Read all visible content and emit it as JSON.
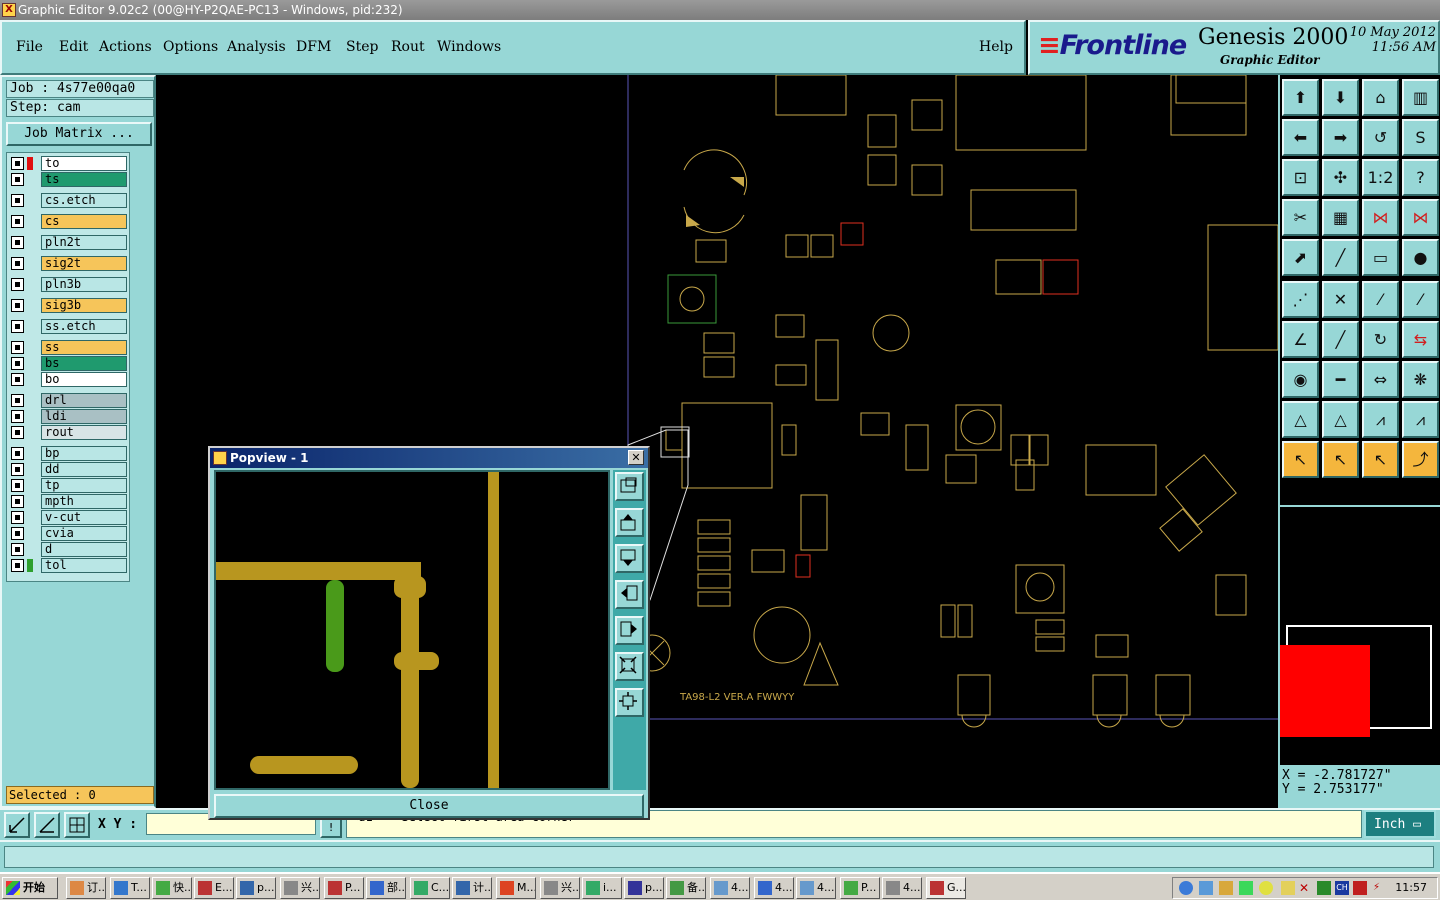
{
  "window": {
    "title": "Graphic Editor 9.02c2 (00@HY-P2QAE-PC13 - Windows, pid:232)"
  },
  "menu": {
    "items": [
      "File",
      "Edit",
      "Actions",
      "Options",
      "Analysis",
      "DFM",
      "Step",
      "Rout",
      "Windows"
    ],
    "help": "Help"
  },
  "brand": {
    "logo": "Frontline",
    "product": "Genesis 2000",
    "subtitle": "Graphic Editor",
    "date": "10 May 2012",
    "time": "11:56 AM"
  },
  "job": {
    "job_label": "Job : 4s77e00qa0",
    "step_label": "Step: cam",
    "matrix_button": "Job Matrix ..."
  },
  "layers": [
    {
      "name": "to",
      "color": "#ffffff",
      "swatch": "#e01010"
    },
    {
      "name": "ts",
      "color": "#1f9a6e",
      "swatch": ""
    },
    {
      "name": "cs.etch",
      "color": "#b9e6e5",
      "swatch": ""
    },
    {
      "name": "cs",
      "color": "#f6c55a",
      "swatch": ""
    },
    {
      "name": "pln2t",
      "color": "#b9e6e5",
      "swatch": ""
    },
    {
      "name": "sig2t",
      "color": "#f6c55a",
      "swatch": ""
    },
    {
      "name": "pln3b",
      "color": "#b9e6e5",
      "swatch": ""
    },
    {
      "name": "sig3b",
      "color": "#f6c55a",
      "swatch": ""
    },
    {
      "name": "ss.etch",
      "color": "#b9e6e5",
      "swatch": ""
    },
    {
      "name": "ss",
      "color": "#f6c55a",
      "swatch": ""
    },
    {
      "name": "bs",
      "color": "#1f9a6e",
      "swatch": ""
    },
    {
      "name": "bo",
      "color": "#ffffff",
      "swatch": ""
    },
    {
      "name": "drl",
      "color": "#a9c0c4",
      "swatch": ""
    },
    {
      "name": "ldi",
      "color": "#a9c0c4",
      "swatch": ""
    },
    {
      "name": "rout",
      "color": "#d8e4e6",
      "swatch": ""
    },
    {
      "name": "bp",
      "color": "#b9e6e5",
      "swatch": ""
    },
    {
      "name": "dd",
      "color": "#b9e6e5",
      "swatch": ""
    },
    {
      "name": "tp",
      "color": "#b9e6e5",
      "swatch": ""
    },
    {
      "name": "mpth",
      "color": "#b9e6e5",
      "swatch": ""
    },
    {
      "name": "v-cut",
      "color": "#b9e6e5",
      "swatch": ""
    },
    {
      "name": "cvia",
      "color": "#b9e6e5",
      "swatch": ""
    },
    {
      "name": "d",
      "color": "#b9e6e5",
      "swatch": ""
    },
    {
      "name": "tol",
      "color": "#b9e6e5",
      "swatch": "#2ea02e"
    }
  ],
  "selection": {
    "label": "Selected : 0"
  },
  "board": {
    "silkscreen": "TA98-L2 VER.A FWWYY"
  },
  "coords": {
    "x": "X = -2.781727\"",
    "y": "Y = 2.753177\""
  },
  "bottom": {
    "xy_label": "X Y :",
    "message": "<d1> - Select first area corner",
    "unit": "Inch"
  },
  "popup": {
    "title": "Popview - 1",
    "close_label": "Close"
  },
  "taskbar": {
    "start": "开始",
    "tasks": [
      "订..",
      "T...",
      "快..",
      "E...",
      "p...",
      "兴..",
      "P...",
      "部..",
      "C...",
      "计..",
      "M...",
      "兴..",
      "i...",
      "p...",
      "备..",
      "4...",
      "4...",
      "4...",
      "P...",
      "4...",
      "G..."
    ],
    "clock": "11:57"
  },
  "colors": {
    "panel": "#97d7d6",
    "pcb": "#c8a84a",
    "selection": "#ff0000"
  }
}
